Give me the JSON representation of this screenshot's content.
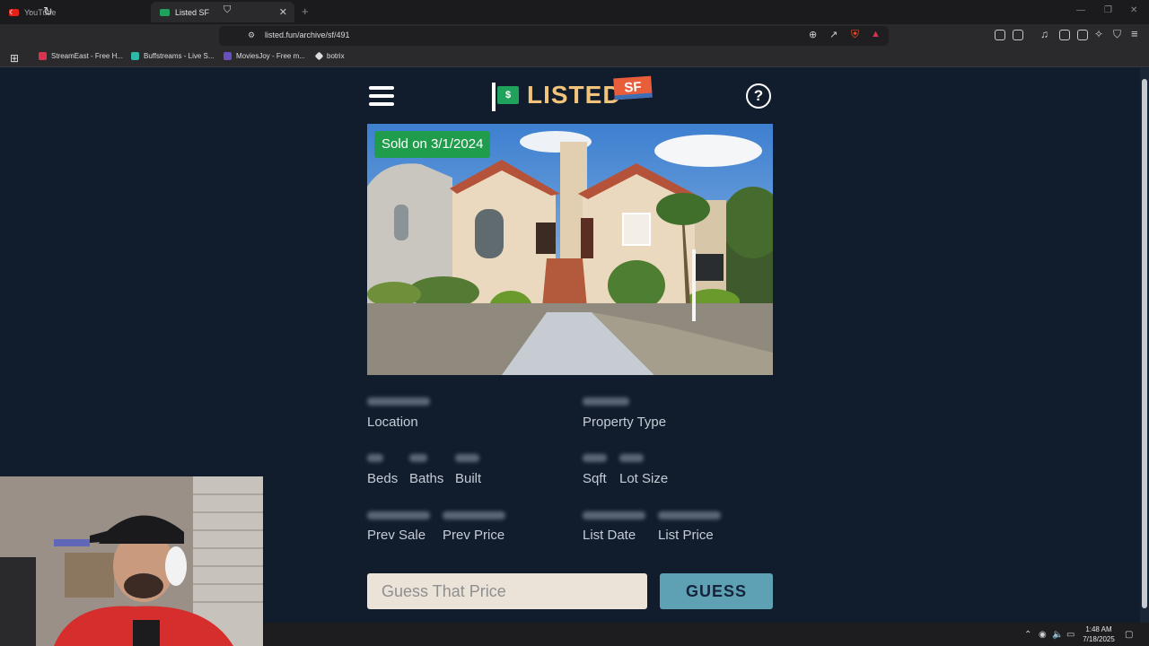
{
  "browser": {
    "tabs": [
      {
        "title": "YouTube",
        "active": false,
        "favicon_color": "#e62117"
      },
      {
        "title": "Listed SF",
        "active": true,
        "favicon_color": "#1fa35c"
      }
    ],
    "url": "listed.fun/archive/sf/491",
    "bookmarks": [
      {
        "label": "StreamEast - Free H...",
        "color": "#d8344f"
      },
      {
        "label": "Buffstreams - Live S...",
        "color": "#2fb8a8"
      },
      {
        "label": "MoviesJoy - Free m...",
        "color": "#6a4fbf"
      },
      {
        "label": "botrix",
        "color": "#dcdce0"
      }
    ]
  },
  "site": {
    "logo_word": "LISTED",
    "logo_badge": "SF",
    "logo_sign": "$",
    "help_glyph": "?"
  },
  "listing": {
    "sold_badge": "Sold on 3/1/2024",
    "fields": {
      "location": "Location",
      "property_type": "Property Type",
      "beds": "Beds",
      "baths": "Baths",
      "built": "Built",
      "sqft": "Sqft",
      "lot_size": "Lot Size",
      "prev_sale": "Prev Sale",
      "prev_price": "Prev Price",
      "list_date": "List Date",
      "list_price": "List Price"
    }
  },
  "guess": {
    "placeholder": "Guess That Price",
    "button_label": "GUESS"
  },
  "taskbar": {
    "time": "1:48 AM",
    "date": "7/18/2025"
  },
  "colors": {
    "page_bg": "#111c2d",
    "sold_green": "#1f9c4c",
    "guess_button": "#5ea0b4",
    "logo_gold": "#f2c37a"
  }
}
